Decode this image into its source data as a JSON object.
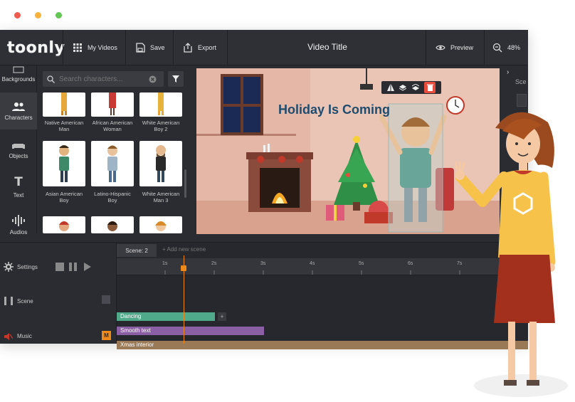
{
  "window_dots": [
    "#f05a4f",
    "#f7b33c",
    "#62c554"
  ],
  "topbar": {
    "logo": "toonly",
    "my_videos": "My Videos",
    "save": "Save",
    "export": "Export",
    "video_title": "Video Title",
    "preview": "Preview",
    "zoom": "48%"
  },
  "rail": {
    "backgrounds": "Backgrounds",
    "characters": "Characters",
    "objects": "Objects",
    "text": "Text",
    "audios": "Audios"
  },
  "search": {
    "placeholder": "Search characters..."
  },
  "characters": [
    {
      "label": "Native American Man"
    },
    {
      "label": "African American Woman"
    },
    {
      "label": "White American Boy 2"
    },
    {
      "label": "Asian American Boy"
    },
    {
      "label": "Latino-Hispanic Boy"
    },
    {
      "label": "White American Man 3"
    }
  ],
  "canvas": {
    "headline": "Holiday Is Coming"
  },
  "right_strip": {
    "label": "Sce"
  },
  "timeline": {
    "settings": "Settings",
    "scene": "Scene",
    "music": "Music",
    "music_badge": "M",
    "scene_tab": "Scene: 2",
    "add_scene": "Add new scene",
    "ticks": [
      "1s",
      "2s",
      "3s",
      "4s",
      "5s",
      "6s",
      "7s"
    ],
    "tracks": [
      {
        "label": "Dancing",
        "color": "#4fa98a"
      },
      {
        "label": "Smooth text",
        "color": "#8b5fa3"
      },
      {
        "label": "Xmas interior",
        "color": "#9a7a56"
      }
    ]
  }
}
